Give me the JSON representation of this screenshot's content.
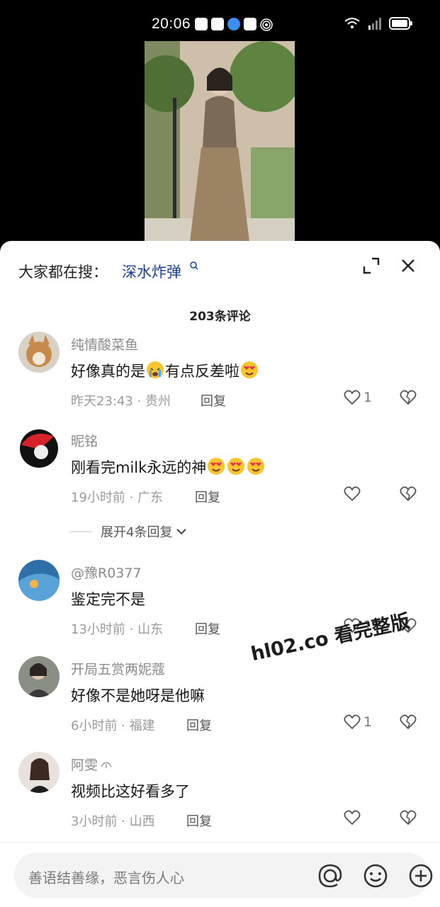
{
  "status_bar": {
    "time": "20:06"
  },
  "sheet": {
    "search_prefix": "大家都在搜：",
    "search_term": "深水炸弹",
    "comment_count": "203条评论"
  },
  "comments": [
    {
      "user": "纯情酸菜鱼",
      "text_a": "好像真的是",
      "text_b": "有点反差啦",
      "time": "昨天23:43",
      "location": "贵州",
      "reply": "回复",
      "likes": "1"
    },
    {
      "user": "昵铭",
      "text_a": "刚看完milk永远的神",
      "time": "19小时前",
      "location": "广东",
      "reply": "回复",
      "likes": "",
      "expand": "展开4条回复"
    },
    {
      "user": "@豫R0377",
      "text_a": "鉴定完不是",
      "time": "13小时前",
      "location": "山东",
      "reply": "回复",
      "likes": "1"
    },
    {
      "user": "开局五赏两妮蔻",
      "text_a": "好像不是她呀是他嘛",
      "time": "6小时前",
      "location": "福建",
      "reply": "回复",
      "likes": "1"
    },
    {
      "user": "阿雯",
      "text_a": "视频比这好看多了",
      "time": "3小时前",
      "location": "山西",
      "reply": "回复",
      "likes": ""
    }
  ],
  "watermark": "hl02.co 看完整版",
  "input": {
    "placeholder": "善语结善缘，恶言伤人心"
  }
}
